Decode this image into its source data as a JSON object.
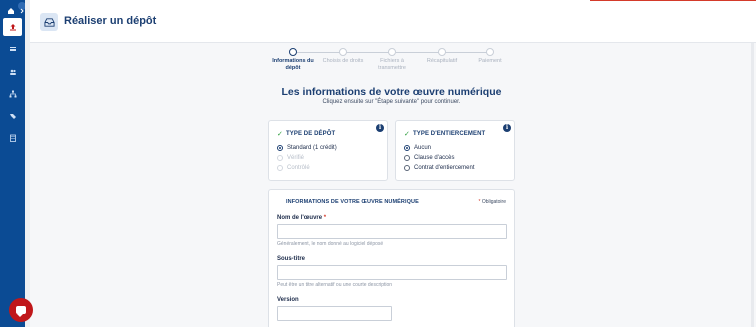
{
  "header": {
    "title": "Réaliser un dépôt",
    "icon": "deposit-box-icon"
  },
  "sidebar": {
    "items": [
      {
        "name": "home-icon"
      },
      {
        "name": "upload-icon",
        "active": true
      },
      {
        "name": "cards-icon"
      },
      {
        "name": "users-icon"
      },
      {
        "name": "network-icon"
      },
      {
        "name": "tag-icon"
      },
      {
        "name": "building-icon"
      }
    ]
  },
  "stepper": {
    "steps": [
      {
        "label": "Informations du dépôt",
        "active": true
      },
      {
        "label": "Choisis de droits",
        "active": false
      },
      {
        "label": "Fichiers à transmettre",
        "active": false
      },
      {
        "label": "Récapitulatif",
        "active": false
      },
      {
        "label": "Paiement",
        "active": false
      }
    ]
  },
  "main": {
    "title": "Les informations de votre œuvre numérique",
    "subtitle": "Cliquez ensuite sur \"Étape suivante\" pour continuer."
  },
  "deposit_type": {
    "heading": "TYPE DE DÉPÔT",
    "options": [
      {
        "label": "Standard (1 crédit)",
        "selected": true,
        "disabled": false
      },
      {
        "label": "Vérifié",
        "selected": false,
        "disabled": true
      },
      {
        "label": "Contrôlé",
        "selected": false,
        "disabled": true
      }
    ]
  },
  "escrow_type": {
    "heading": "TYPE D'ENTIERCEMENT",
    "options": [
      {
        "label": "Aucun",
        "selected": true,
        "disabled": false
      },
      {
        "label": "Clause d'accès",
        "selected": false,
        "disabled": false
      },
      {
        "label": "Contrat d'entiercement",
        "selected": false,
        "disabled": false
      }
    ]
  },
  "work_info": {
    "heading": "INFORMATIONS DE VOTRE ŒUVRE NUMÉRIQUE",
    "required_note": "Obligatoire",
    "fields": [
      {
        "label": "Nom de l'œuvre",
        "required": true,
        "value": "",
        "help": "Généralement, le nom donné au logiciel déposé"
      },
      {
        "label": "Sous-titre",
        "required": false,
        "value": "",
        "help": "Peut être un titre alternatif ou une courte description"
      },
      {
        "label": "Version",
        "required": false,
        "value": "",
        "help": ""
      }
    ]
  },
  "colors": {
    "primary": "#1c3f72",
    "sidebar": "#0b4b94",
    "accent_red": "#c0171a",
    "check_green": "#2e9e3e"
  }
}
